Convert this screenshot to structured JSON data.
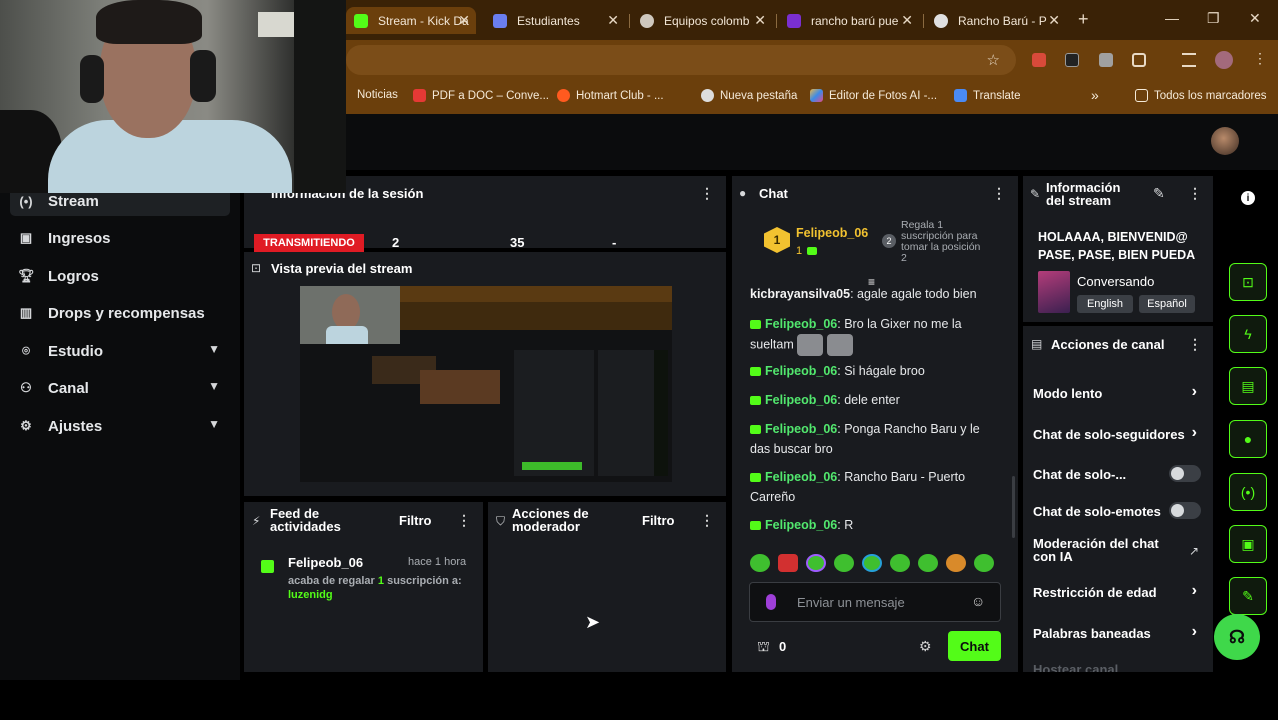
{
  "browser": {
    "tabs": [
      {
        "label": "Stream - Kick Da",
        "color": "#53fc18"
      },
      {
        "label": "Estudiantes",
        "color": "#6a7ef0"
      },
      {
        "label": "Equipos colomb",
        "color": "#cfc8be"
      },
      {
        "label": "rancho barú pue",
        "color": "#7a2fd0"
      },
      {
        "label": "Rancho Barú - P",
        "color": "#e0e0e0"
      }
    ],
    "bookmarks": [
      {
        "label": "Noticias",
        "color": "#c0c0c0"
      },
      {
        "label": "PDF a DOC – Conve...",
        "color": "#e53935"
      },
      {
        "label": "Hotmart Club - ...",
        "color": "#ff5a1f"
      },
      {
        "label": "Nueva pestaña",
        "color": "#dddddd"
      },
      {
        "label": "Editor de Fotos AI -...",
        "color": "#e8b54a"
      },
      {
        "label": "Translate",
        "color": "#4a8af4"
      }
    ],
    "bookmarks_more": "»",
    "all_bookmarks": "Todos los marcadores"
  },
  "sidebar": {
    "items": [
      {
        "label": "Stream",
        "icon": "broadcast-icon"
      },
      {
        "label": "Ingresos",
        "icon": "wallet-icon"
      },
      {
        "label": "Logros",
        "icon": "trophy-icon"
      },
      {
        "label": "Drops y recompensas",
        "icon": "gift-icon"
      },
      {
        "label": "Estudio",
        "icon": "studio-icon"
      },
      {
        "label": "Canal",
        "icon": "users-icon"
      },
      {
        "label": "Ajustes",
        "icon": "gear-icon"
      }
    ]
  },
  "session": {
    "title": "Información de la sesión",
    "status": "TRANSMITIENDO",
    "stats": [
      "2",
      "35",
      "-"
    ]
  },
  "preview": {
    "title": "Vista previa del stream"
  },
  "feed": {
    "title": "Feed de actividades",
    "filter": "Filtro",
    "item": {
      "user": "Felipeob_06",
      "time": "hace 1 hora",
      "text_a": "acaba de regalar",
      "count": "1",
      "text_b": "suscripción a:",
      "target": "luzenidg"
    }
  },
  "modactions": {
    "title": "Acciones de moderador",
    "filter": "Filtro"
  },
  "chat": {
    "title": "Chat",
    "pinned": {
      "rank": "1",
      "user": "Felipeob_06",
      "count": "1",
      "hint_rank": "2",
      "hint": "Regala 1 suscripción para tomar la posición 2"
    },
    "messages": [
      {
        "user": "kicbrayansilva05",
        "text": "agale agale todo bien",
        "badge": false
      },
      {
        "user": "Felipeob_06",
        "text": "Bro la Gixer no me la sueltam",
        "badge": true
      },
      {
        "user": "Felipeob_06",
        "text": "Si hágale broo",
        "badge": true
      },
      {
        "user": "Felipeob_06",
        "text": "dele enter",
        "badge": true
      },
      {
        "user": "Felipeob_06",
        "text": "Ponga Rancho Baru y le das buscar bro",
        "badge": true
      },
      {
        "user": "Felipeob_06",
        "text": "Rancho Baru - Puerto Carreño",
        "badge": true
      },
      {
        "user": "Felipeob_06",
        "text": "R",
        "badge": true
      }
    ],
    "input_placeholder": "Enviar un mensaje",
    "points": "0",
    "send": "Chat"
  },
  "info": {
    "title": "Información del stream",
    "stream_title": "HOLAAAA, BIENVENID@ PASE, PASE, BIEN PUEDA",
    "category": "Conversando",
    "tags": [
      "English",
      "Español"
    ]
  },
  "channel": {
    "title": "Acciones de canal",
    "rows": [
      {
        "label": "Modo lento",
        "control": "chevron"
      },
      {
        "label": "Chat de solo-seguidores",
        "control": "chevron"
      },
      {
        "label": "Chat de solo-...",
        "control": "toggle"
      },
      {
        "label": "Chat de solo-emotes",
        "control": "toggle"
      },
      {
        "label": "Moderación del chat con IA",
        "control": "external"
      },
      {
        "label": "Restricción de edad",
        "control": "chevron"
      },
      {
        "label": "Palabras baneadas",
        "control": "chevron"
      },
      {
        "label": "Hostear canal",
        "control": "none"
      }
    ]
  },
  "colors": {
    "accent": "#53fc18",
    "live": "#e01b24",
    "chrome": "#6b3f0c"
  }
}
